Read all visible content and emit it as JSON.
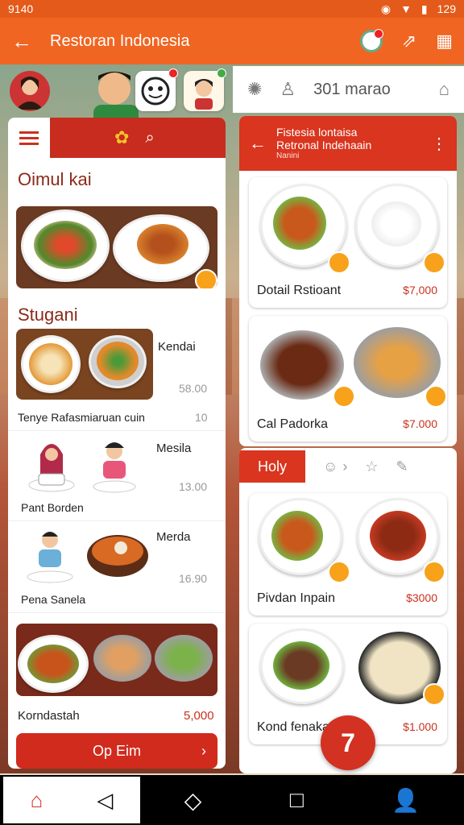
{
  "status": {
    "time": "9140",
    "battery": "129"
  },
  "appbar": {
    "title": "Restoran Indonesia"
  },
  "top_bar": {
    "text": "301 marao"
  },
  "left": {
    "section1_title": "Oimul kai",
    "section2_title": "Stugani",
    "items": [
      {
        "title": "Kendai",
        "price": "58.00",
        "caption": "Tenye Rafasmiaruan cuin",
        "count": "10"
      },
      {
        "title": "Mesila",
        "price": "13.00",
        "caption": "Pant Borden"
      },
      {
        "title": "Merda",
        "price": "16.90",
        "caption": "Pena Sanela"
      }
    ],
    "bottom_item": {
      "caption": "Korndastah",
      "price": "5,000"
    },
    "button_label": "Op Eim"
  },
  "right": {
    "header": {
      "line1": "Fistesia lontaisa",
      "line2": "Retronal Indehaain",
      "line3": "Nanini"
    },
    "dishes": [
      {
        "name": "Dotail Rstioant",
        "price": "$7,000"
      },
      {
        "name": "Cal Padorka",
        "price": "$7.000"
      }
    ],
    "tab_label": "Holy",
    "dishes2": [
      {
        "name": "Pivdan Inpain",
        "price": "$3000"
      },
      {
        "name": "Kond fenaka",
        "price": "$1.000"
      }
    ]
  },
  "fab_label": "7",
  "colors": {
    "primary": "#f06522",
    "accent": "#d9351f"
  }
}
